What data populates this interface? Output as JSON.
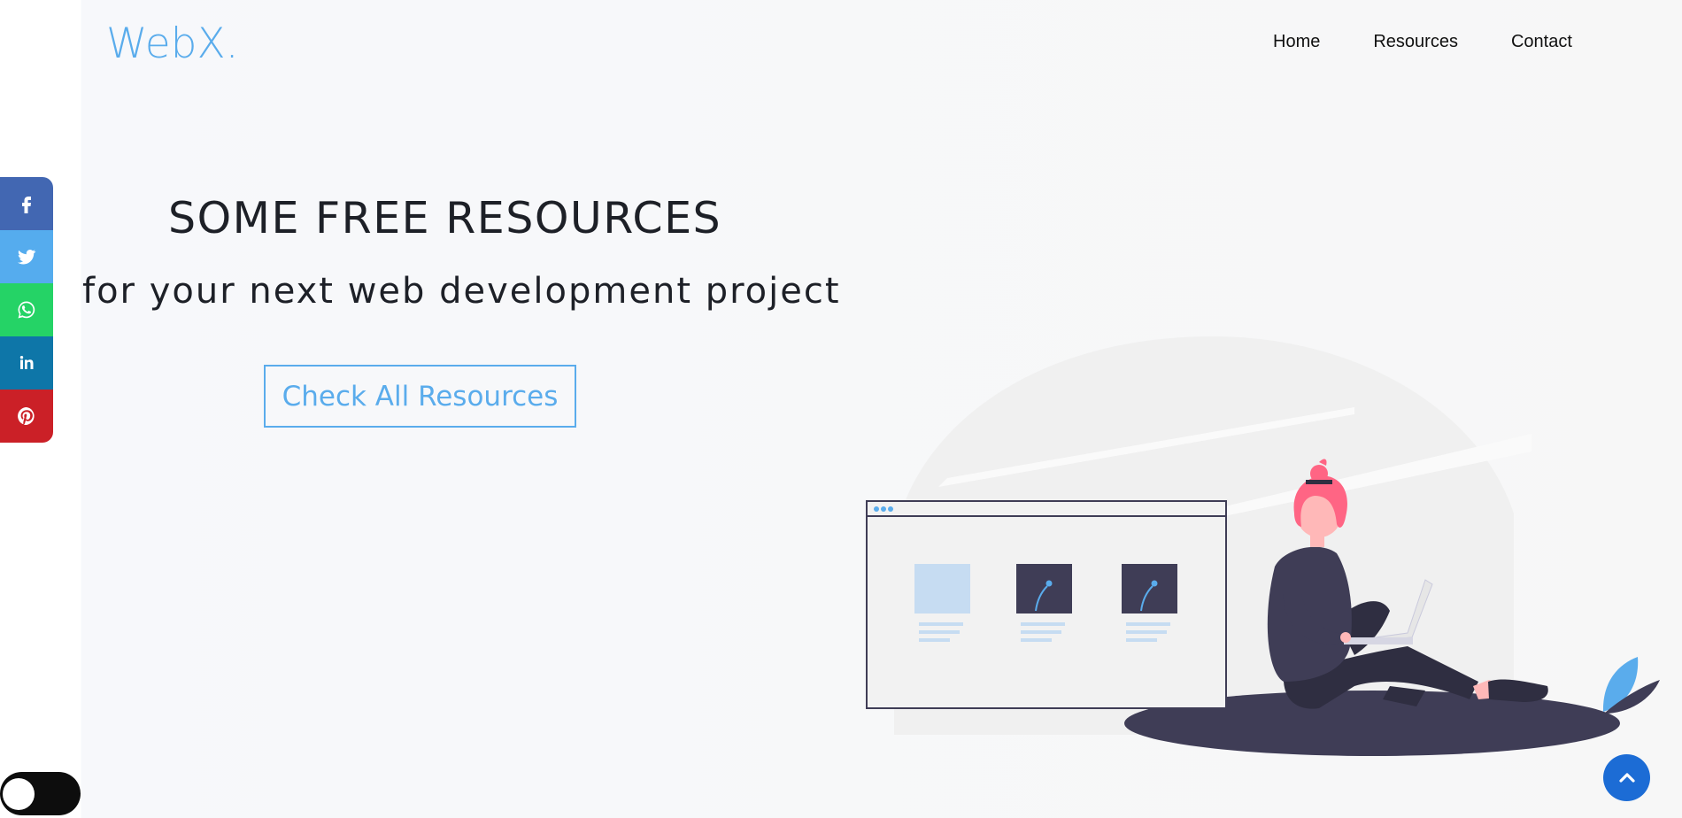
{
  "brand": {
    "logo": "WebX."
  },
  "nav": {
    "items": [
      "Home",
      "Resources",
      "Contact"
    ]
  },
  "hero": {
    "title": "SOME FREE RESOURCES",
    "subtitle": "for your next web development project",
    "cta": "Check All Resources"
  },
  "social": [
    {
      "name": "facebook",
      "icon": "facebook-icon",
      "color": "#4267b2"
    },
    {
      "name": "twitter",
      "icon": "twitter-icon",
      "color": "#55acee"
    },
    {
      "name": "whatsapp",
      "icon": "whatsapp-icon",
      "color": "#25d366"
    },
    {
      "name": "linkedin",
      "icon": "linkedin-icon",
      "color": "#0e76a8"
    },
    {
      "name": "pinterest",
      "icon": "pinterest-icon",
      "color": "#cb2027"
    }
  ],
  "colors": {
    "accent": "#5aacec",
    "dark": "#3f3d56",
    "totop": "#1c6cd5",
    "hair": "#ff6584"
  }
}
